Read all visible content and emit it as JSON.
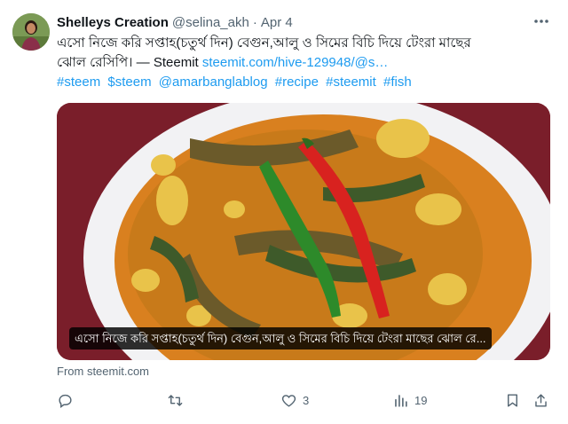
{
  "author": {
    "name": "Shelleys Creation",
    "handle": "@selina_akh",
    "separator": "·",
    "date": "Apr 4"
  },
  "tweet": {
    "text_line1": "এসো নিজে করি সপ্তাহ(চতুর্থ দিন) বেগুন,আলু ও সিমের বিচি দিয়ে টেংরা মাছের",
    "text_line2_prefix": "ঝোল রেসিপি। — Steemit ",
    "link": "steemit.com/hive-129948/@s…",
    "hashtags": [
      "#steem",
      "$steem",
      "@amarbanglablog",
      "#recipe",
      "#steemit",
      "#fish"
    ]
  },
  "media": {
    "caption": "এসো নিজে করি সপ্তাহ(চতুর্থ দিন) বেগুন,আলু ও সিমের বিচি দিয়ে টেংরা মাছের ঝোল রে...",
    "source": "From steemit.com"
  },
  "actions": {
    "reply_count": "",
    "retweet_count": "",
    "like_count": "3",
    "views_count": "19"
  },
  "colors": {
    "link": "#1d9bf0",
    "muted": "#536471",
    "text": "#0f1419"
  },
  "icons": [
    "more-icon",
    "reply-icon",
    "retweet-icon",
    "like-icon",
    "views-icon",
    "bookmark-icon",
    "share-icon"
  ]
}
